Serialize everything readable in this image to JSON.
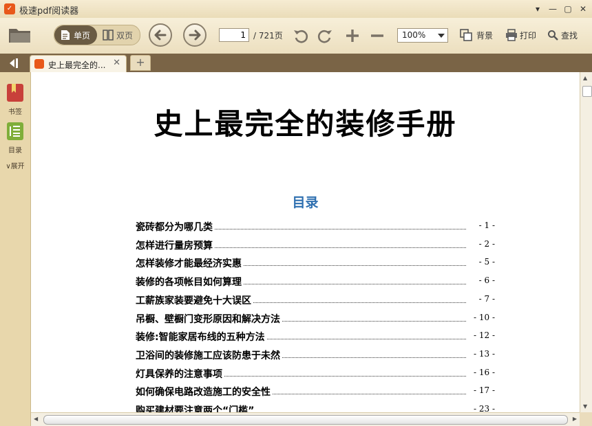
{
  "window": {
    "title": "极速pdf阅读器"
  },
  "toolbar": {
    "single_page": "单页",
    "double_page": "双页",
    "current_page": "1",
    "total_pages": "/ 721页",
    "zoom": "100%",
    "background": "背景",
    "print": "打印",
    "find": "查找"
  },
  "tabs": [
    {
      "label": "史上最完全的..."
    }
  ],
  "sidebar": {
    "bookmark": "书签",
    "toc": "目录",
    "expand": "展开"
  },
  "document": {
    "title": "史上最完全的装修手册",
    "toc_heading": "目录",
    "toc": [
      {
        "title": "瓷砖都分为哪几类",
        "page": "- 1 -"
      },
      {
        "title": "怎样进行量房预算",
        "page": "- 2 -"
      },
      {
        "title": "怎样装修才能最经济实惠",
        "page": "- 5 -"
      },
      {
        "title": "装修的各项帐目如何算理",
        "page": "- 6 -"
      },
      {
        "title": "工薪族家装要避免十大误区",
        "page": "- 7 -"
      },
      {
        "title": "吊橱、壁橱门变形原因和解决方法",
        "page": "- 10 -"
      },
      {
        "title": "装修:智能家居布线的五种方法",
        "page": "- 12 -"
      },
      {
        "title": "卫浴间的装修施工应该防患于未然",
        "page": "- 13 -"
      },
      {
        "title": "灯具保养的注意事项",
        "page": "- 16 -"
      },
      {
        "title": "如何确保电路改造施工的安全性",
        "page": "- 17 -"
      },
      {
        "title": "购买建材要注意两个“门槛”",
        "page": "- 23 -"
      }
    ]
  },
  "colors": {
    "accent": "#e8581a",
    "toc_heading": "#2e6fb0",
    "tabbar": "#7a6446"
  }
}
